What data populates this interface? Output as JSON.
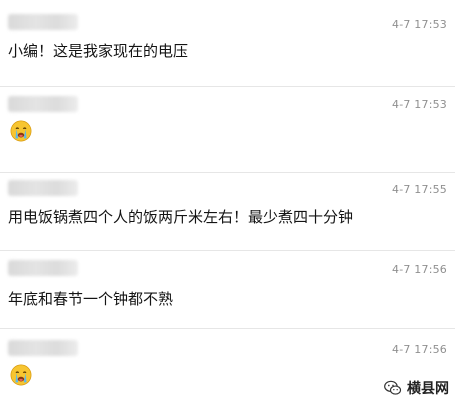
{
  "messages": [
    {
      "time": "4-7 17:53",
      "content": "小编！这是我家现在的电压",
      "emoji": null
    },
    {
      "time": "4-7 17:53",
      "content": "",
      "emoji": "crying-face-icon"
    },
    {
      "time": "4-7 17:55",
      "content": "用电饭锅煮四个人的饭两斤米左右！最少煮四十分钟",
      "emoji": null
    },
    {
      "time": "4-7 17:56",
      "content": "年底和春节一个钟都不熟",
      "emoji": null
    },
    {
      "time": "4-7 17:56",
      "content": "",
      "emoji": "crying-face-icon"
    }
  ],
  "watermark": {
    "text": "横县网",
    "icon": "wechat-icon"
  },
  "colors": {
    "background": "#ffffff",
    "time": "#8f8f8f",
    "text": "#141414",
    "divider": "#e6e6e6"
  }
}
